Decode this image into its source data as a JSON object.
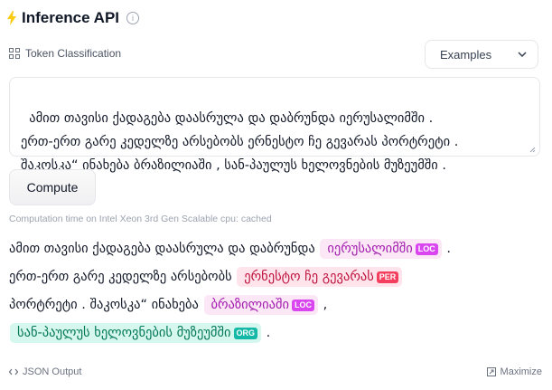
{
  "header": {
    "title": "Inference API",
    "info_glyph": "i"
  },
  "task": {
    "label": "Token Classification",
    "icon": "token-classification-icon"
  },
  "examples": {
    "label": "Examples"
  },
  "input": {
    "text": "ამით თავისი ქადაგება დაასრულა და დაბრუნდა იერუსალიმში .\nერთ-ერთ გარე კედელზე არსებობს ერნესტო ჩე გევარას პორტრეტი .\nშაკოსკა“ ინახება ბრაზილიაში , სან-პაულუს ხელოვნების მუზეუმში ."
  },
  "compute": {
    "label": "Compute"
  },
  "computation_time": "Computation time on Intel Xeon 3rd Gen Scalable cpu: cached",
  "output": {
    "line1_text": "ამით თავისი ქადაგება დაასრულა და დაბრუნდა ",
    "ent1": {
      "text": "იერუსალიმში",
      "label": "LOC"
    },
    "line1_end": " .",
    "line2_text": "ერთ-ერთ გარე კედელზე არსებობს ",
    "ent2": {
      "text": "ერნესტო ჩე გევარას",
      "label": "PER"
    },
    "line3_text": "პორტრეტი . შაკოსკა“ ინახება ",
    "ent3": {
      "text": "ბრაზილიაში",
      "label": "LOC"
    },
    "comma": " , ",
    "ent4": {
      "text": "სან-პაულუს ხელოვნების მუზეუმში",
      "label": "ORG"
    },
    "line4_end": " ."
  },
  "footer": {
    "json_output": "JSON Output",
    "maximize": "Maximize"
  },
  "colors": {
    "loc": "#d946ef",
    "per": "#f43f5e",
    "org": "#14b8a6",
    "bolt": "#facc15"
  }
}
